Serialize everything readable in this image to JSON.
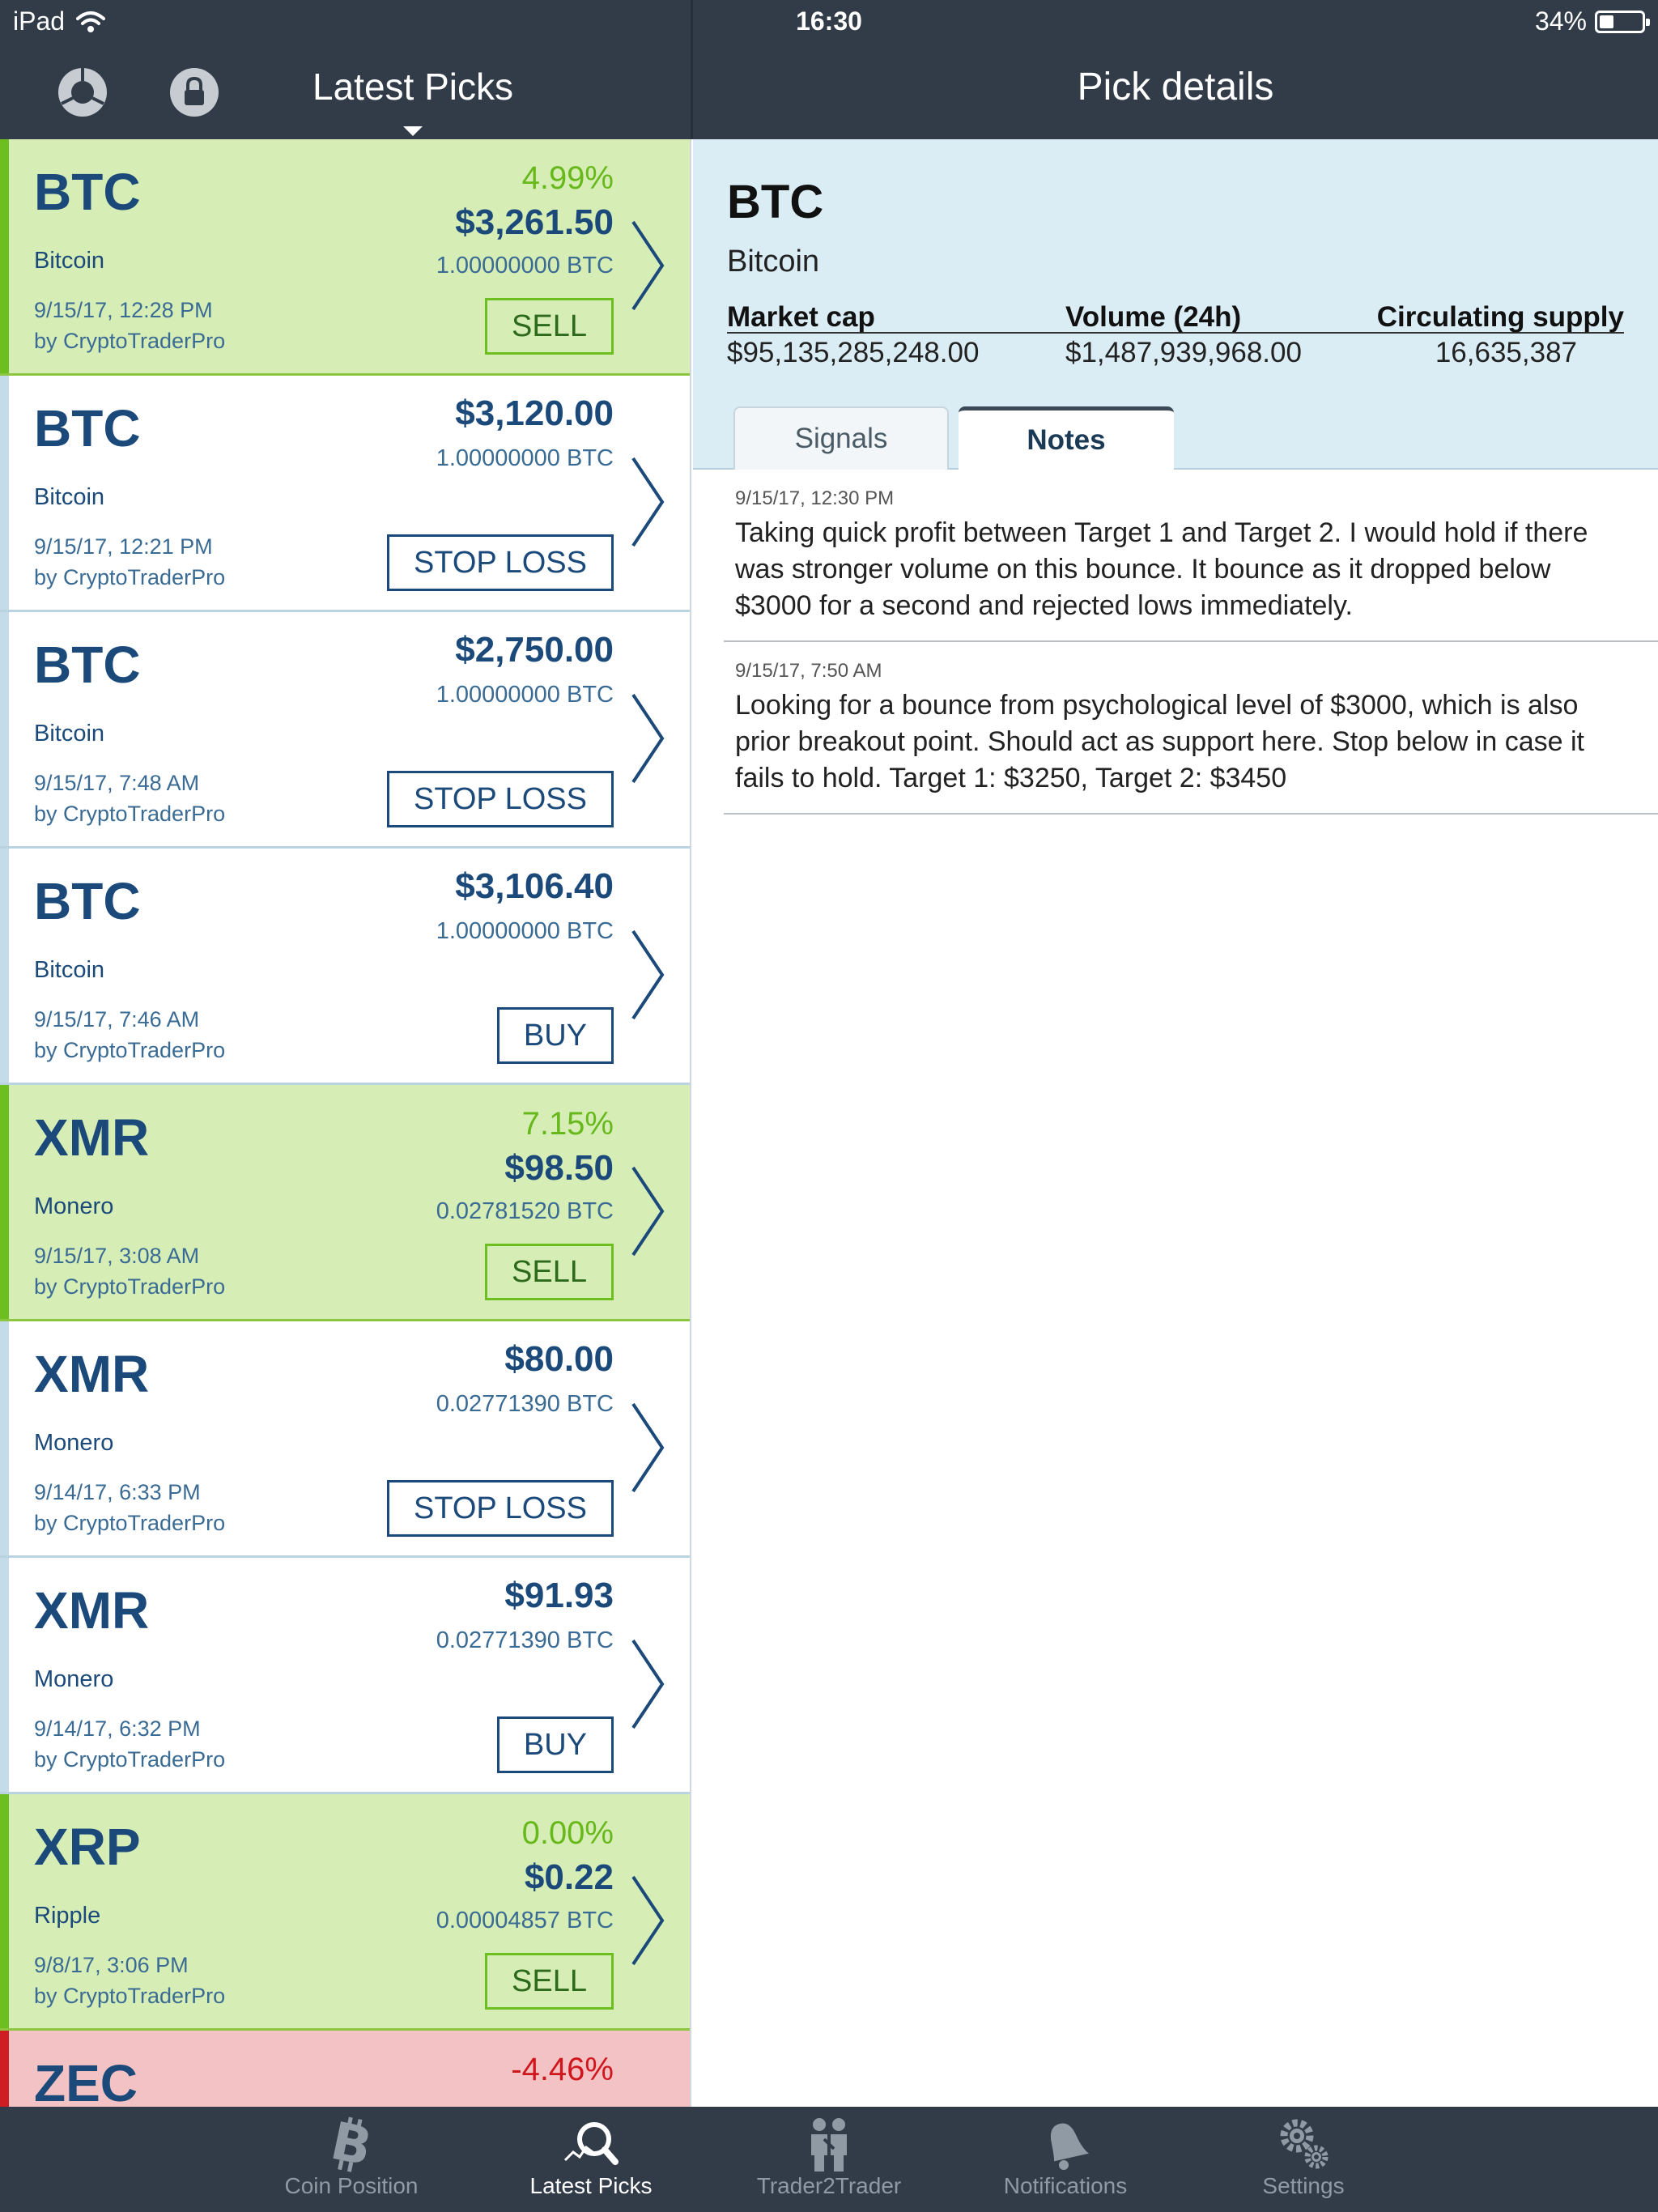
{
  "status_bar": {
    "device": "iPad",
    "time": "16:30",
    "battery": "34%",
    "battery_level": 0.34
  },
  "left_header": {
    "title": "Latest Picks"
  },
  "right_header": {
    "title": "Pick details"
  },
  "picks": [
    {
      "symbol": "BTC",
      "name": "Bitcoin",
      "date": "9/15/17, 12:28 PM",
      "by": "by CryptoTraderPro",
      "percent": "4.99%",
      "price": "$3,261.50",
      "btc": "1.00000000 BTC",
      "action": "SELL",
      "state": "green"
    },
    {
      "symbol": "BTC",
      "name": "Bitcoin",
      "date": "9/15/17, 12:21 PM",
      "by": "by CryptoTraderPro",
      "percent": "",
      "price": "$3,120.00",
      "btc": "1.00000000 BTC",
      "action": "STOP LOSS",
      "state": "plain"
    },
    {
      "symbol": "BTC",
      "name": "Bitcoin",
      "date": "9/15/17, 7:48 AM",
      "by": "by CryptoTraderPro",
      "percent": "",
      "price": "$2,750.00",
      "btc": "1.00000000 BTC",
      "action": "STOP LOSS",
      "state": "plain"
    },
    {
      "symbol": "BTC",
      "name": "Bitcoin",
      "date": "9/15/17, 7:46 AM",
      "by": "by CryptoTraderPro",
      "percent": "",
      "price": "$3,106.40",
      "btc": "1.00000000 BTC",
      "action": "BUY",
      "state": "plain"
    },
    {
      "symbol": "XMR",
      "name": "Monero",
      "date": "9/15/17, 3:08 AM",
      "by": "by CryptoTraderPro",
      "percent": "7.15%",
      "price": "$98.50",
      "btc": "0.02781520 BTC",
      "action": "SELL",
      "state": "green"
    },
    {
      "symbol": "XMR",
      "name": "Monero",
      "date": "9/14/17, 6:33 PM",
      "by": "by CryptoTraderPro",
      "percent": "",
      "price": "$80.00",
      "btc": "0.02771390 BTC",
      "action": "STOP LOSS",
      "state": "plain"
    },
    {
      "symbol": "XMR",
      "name": "Monero",
      "date": "9/14/17, 6:32 PM",
      "by": "by CryptoTraderPro",
      "percent": "",
      "price": "$91.93",
      "btc": "0.02771390 BTC",
      "action": "BUY",
      "state": "plain"
    },
    {
      "symbol": "XRP",
      "name": "Ripple",
      "date": "9/8/17, 3:06 PM",
      "by": "by CryptoTraderPro",
      "percent": "0.00%",
      "price": "$0.22",
      "btc": "0.00004857 BTC",
      "action": "SELL",
      "state": "green"
    },
    {
      "symbol": "ZEC",
      "name": "",
      "date": "",
      "by": "",
      "percent": "-4.46%",
      "price": "",
      "btc": "",
      "action": "",
      "state": "red"
    }
  ],
  "detail": {
    "symbol": "BTC",
    "name": "Bitcoin",
    "stats_headers": [
      "Market cap",
      "Volume (24h)",
      "Circulating supply"
    ],
    "stats_values": [
      "$95,135,285,248.00",
      "$1,487,939,968.00",
      "16,635,387"
    ],
    "tabs": [
      {
        "label": "Signals",
        "active": false
      },
      {
        "label": "Notes",
        "active": true
      }
    ],
    "notes": [
      {
        "date": "9/15/17, 12:30 PM",
        "text": "Taking quick profit between Target 1 and Target 2. I would hold if there was stronger volume on this bounce. It bounce as it dropped below $3000 for a second and rejected lows immediately."
      },
      {
        "date": "9/15/17, 7:50 AM",
        "text": "Looking for a bounce from psychological level of $3000, which is also prior breakout point. Should act as support here. Stop below in case it fails to hold. Target 1: $3250, Target 2: $3450"
      }
    ]
  },
  "tabbar": [
    {
      "label": "Coin Position",
      "icon": "bitcoin-icon",
      "active": false
    },
    {
      "label": "Latest Picks",
      "icon": "search-chart-icon",
      "active": true
    },
    {
      "label": "Trader2Trader",
      "icon": "people-icon",
      "active": false
    },
    {
      "label": "Notifications",
      "icon": "bell-icon",
      "active": false
    },
    {
      "label": "Settings",
      "icon": "gears-icon",
      "active": false
    }
  ],
  "colors": {
    "header": "#323c48",
    "green_row": "#d6eeb6",
    "green_accent": "#6cbf1e",
    "red_row": "#f2c2c4",
    "red_accent": "#d0161d",
    "detail_bg": "#daecf4",
    "text_blue": "#1b4a7a"
  }
}
